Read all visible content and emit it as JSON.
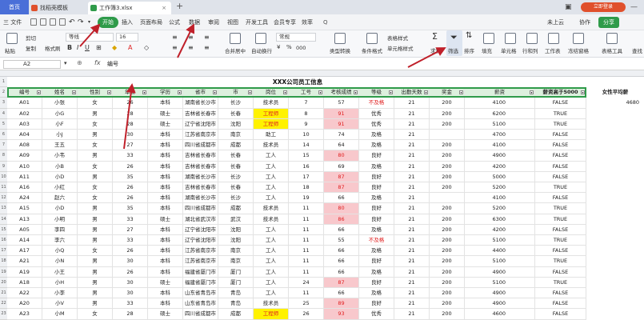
{
  "tabs": {
    "home": "首页",
    "template": "找稻壳模板",
    "doc": "工作簿3.xlsx",
    "login": "立即登录"
  },
  "menu": {
    "file": "三 文件",
    "items": [
      "开始",
      "插入",
      "页面布局",
      "公式",
      "数据",
      "审阅",
      "视图",
      "开发工具",
      "会员专享",
      "效率"
    ],
    "search": "Q",
    "cloud": "未上云",
    "collab": "协作",
    "share": "分享"
  },
  "ribbon": {
    "paste": "粘贴",
    "cut": "剪切",
    "copy": "复制",
    "format_painter": "格式刷",
    "font_name": "等线",
    "font_size": "16",
    "merge": "合并居中",
    "wrap": "自动换行",
    "num_format": "常规",
    "table_style": "表格样式",
    "cond_format": "条件格式",
    "cell_style": "单元格样式",
    "sum": "求和",
    "filter": "筛选",
    "sort": "排序",
    "fill": "填充",
    "cells": "单元格",
    "rowcol": "行和列",
    "sheet": "工作表",
    "freeze": "冻结窗格",
    "table_tools": "表格工具",
    "find": "查找",
    "thousands": "000",
    "convert": "类型转换"
  },
  "formula": {
    "name_box": "A2",
    "fx": "fx",
    "value": "编号"
  },
  "sheet": {
    "title": "XXX公司员工信息",
    "headers": [
      "编号",
      "姓名",
      "性别",
      "年龄",
      "学历",
      "省市",
      "市",
      "岗位",
      "工号",
      "考核成绩",
      "等级",
      "出勤天数",
      "奖金",
      "薪资",
      "薪资高于5000"
    ],
    "extra_header": "女性平均薪",
    "extra_value": "4680",
    "row_numbers": [
      "1",
      "2",
      "3",
      "4",
      "5",
      "6",
      "7",
      "8",
      "9",
      "10",
      "11",
      "12",
      "13",
      "14",
      "15",
      "16",
      "17",
      "18",
      "19",
      "20",
      "21",
      "22",
      "23"
    ],
    "rows": [
      [
        "A01",
        "小张",
        "女",
        "26",
        "本科",
        "湖南省长沙市",
        "长沙",
        "技术员",
        "7",
        "57",
        "不及格",
        "21",
        "200",
        "4100",
        "FALSE"
      ],
      [
        "A02",
        "小G",
        "男",
        "28",
        "硕士",
        "吉林省长春市",
        "长春",
        "工程师",
        "8",
        "91",
        "优秀",
        "21",
        "200",
        "6200",
        "TRUE"
      ],
      [
        "A03",
        "小F",
        "女",
        "28",
        "硕士",
        "辽宁省沈阳市",
        "沈阳",
        "工程师",
        "9",
        "91",
        "优秀",
        "21",
        "200",
        "5100",
        "TRUE"
      ],
      [
        "A04",
        "小J",
        "男",
        "30",
        "本科",
        "江苏省南京市",
        "南京",
        "助工",
        "10",
        "74",
        "及格",
        "21",
        "",
        "4700",
        "FALSE"
      ],
      [
        "A08",
        "王五",
        "女",
        "27",
        "本科",
        "四川省成都市",
        "成都",
        "技术员",
        "14",
        "64",
        "及格",
        "21",
        "200",
        "4100",
        "FALSE"
      ],
      [
        "A09",
        "小韦",
        "男",
        "33",
        "本科",
        "吉林省长春市",
        "长春",
        "工人",
        "15",
        "80",
        "良好",
        "21",
        "200",
        "4900",
        "FALSE"
      ],
      [
        "A10",
        "小B",
        "女",
        "26",
        "本科",
        "吉林省长春市",
        "长春",
        "工人",
        "16",
        "69",
        "及格",
        "21",
        "200",
        "4200",
        "FALSE"
      ],
      [
        "A11",
        "小D",
        "男",
        "35",
        "本科",
        "湖南省长沙市",
        "长沙",
        "工人",
        "17",
        "87",
        "良好",
        "21",
        "200",
        "5000",
        "FALSE"
      ],
      [
        "A16",
        "小红",
        "女",
        "26",
        "本科",
        "吉林省长春市",
        "长春",
        "工人",
        "18",
        "87",
        "良好",
        "21",
        "200",
        "5200",
        "TRUE"
      ],
      [
        "A24",
        "赵六",
        "女",
        "26",
        "本科",
        "湖南省长沙市",
        "长沙",
        "工人",
        "19",
        "66",
        "及格",
        "21",
        "",
        "4100",
        "FALSE"
      ],
      [
        "A15",
        "小D",
        "男",
        "35",
        "本科",
        "四川省成都市",
        "成都",
        "技术员",
        "11",
        "80",
        "良好",
        "21",
        "200",
        "5200",
        "TRUE"
      ],
      [
        "A13",
        "小明",
        "男",
        "33",
        "硕士",
        "湖北省武汉市",
        "武汉",
        "技术员",
        "11",
        "86",
        "良好",
        "21",
        "200",
        "6300",
        "TRUE"
      ],
      [
        "A05",
        "李四",
        "男",
        "27",
        "本科",
        "辽宁省沈阳市",
        "沈阳",
        "工人",
        "11",
        "66",
        "及格",
        "21",
        "200",
        "4200",
        "FALSE"
      ],
      [
        "A14",
        "李六",
        "男",
        "33",
        "本科",
        "辽宁省沈阳市",
        "沈阳",
        "工人",
        "11",
        "55",
        "不及格",
        "21",
        "200",
        "5100",
        "TRUE"
      ],
      [
        "A17",
        "小Q",
        "女",
        "26",
        "本科",
        "江苏省南京市",
        "南京",
        "工人",
        "11",
        "66",
        "及格",
        "21",
        "200",
        "4400",
        "FALSE"
      ],
      [
        "A21",
        "小N",
        "男",
        "30",
        "本科",
        "江苏省南京市",
        "南京",
        "工人",
        "11",
        "66",
        "良好",
        "21",
        "200",
        "5100",
        "TRUE"
      ],
      [
        "A19",
        "小王",
        "男",
        "26",
        "本科",
        "福建省厦门市",
        "厦门",
        "工人",
        "11",
        "66",
        "及格",
        "21",
        "200",
        "4900",
        "FALSE"
      ],
      [
        "A18",
        "小H",
        "男",
        "30",
        "硕士",
        "福建省厦门市",
        "厦门",
        "工人",
        "24",
        "87",
        "良好",
        "21",
        "200",
        "5100",
        "TRUE"
      ],
      [
        "A22",
        "小李",
        "男",
        "30",
        "本科",
        "山东省青岛市",
        "青岛",
        "工人",
        "11",
        "66",
        "及格",
        "21",
        "200",
        "4900",
        "FALSE"
      ],
      [
        "A20",
        "小V",
        "男",
        "33",
        "本科",
        "山东省青岛市",
        "青岛",
        "技术员",
        "25",
        "89",
        "良好",
        "21",
        "200",
        "4900",
        "FALSE"
      ],
      [
        "A23",
        "小M",
        "女",
        "28",
        "硕士",
        "四川省成都市",
        "成都",
        "工程师",
        "26",
        "93",
        "优秀",
        "21",
        "200",
        "4600",
        "FALSE"
      ]
    ]
  },
  "colors": {
    "accent": "#2f9b4a",
    "header_fill": "#ddf0de",
    "yellow": "#fff200",
    "pink": "#f8c8cc",
    "fail_red": "#e02020",
    "arrow": "#c0202a"
  }
}
